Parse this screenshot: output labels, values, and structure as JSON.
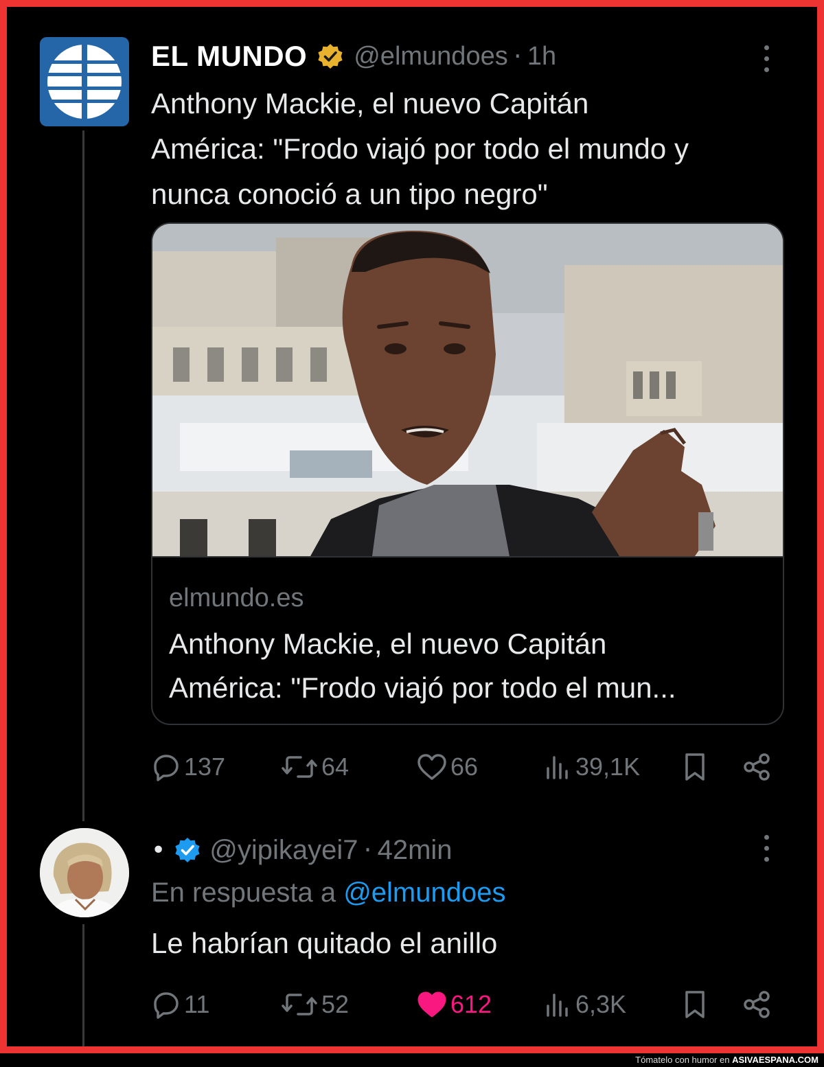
{
  "tweet": {
    "author_name": "EL MUNDO",
    "handle": "@elmundoes",
    "separator": "·",
    "time": "1h",
    "text_lines": [
      "Anthony Mackie, el nuevo Capitán",
      "América: \"Frodo viajó por todo el mundo y",
      "nunca conoció a un tipo negro\""
    ],
    "card": {
      "domain": "elmundo.es",
      "title_lines": [
        "Anthony Mackie, el nuevo Capitán",
        "América: \"Frodo viajó por todo el mun..."
      ]
    },
    "actions": {
      "replies": "137",
      "retweets": "64",
      "likes": "66",
      "views": "39,1K"
    }
  },
  "reply": {
    "bullet": "•",
    "handle": "@yipikayei7",
    "separator": "·",
    "time": "42min",
    "reply_prefix": "En respuesta a",
    "reply_mention": "@elmundoes",
    "text": "Le habrían quitado el anillo",
    "actions": {
      "replies": "11",
      "retweets": "52",
      "likes": "612",
      "views": "6,3K"
    }
  },
  "watermark": {
    "prefix": "Tómatelo con humor en",
    "site": "ASIVAESPANA.COM"
  },
  "colors": {
    "background": "#000000",
    "border": "#ee3333",
    "text": "#e7e9ea",
    "muted": "#71767b",
    "link": "#1d9bf0",
    "like": "#f91880",
    "verified_gold": "#e8b22e",
    "verified_blue": "#1d9bf0",
    "brand_blue": "#2566a8"
  },
  "icons": [
    "el-mundo-logo-icon",
    "gold-verified-badge-icon",
    "blue-verified-badge-icon",
    "more-options-icon",
    "reply-icon",
    "retweet-icon",
    "like-icon",
    "views-icon",
    "bookmark-icon",
    "share-icon"
  ]
}
